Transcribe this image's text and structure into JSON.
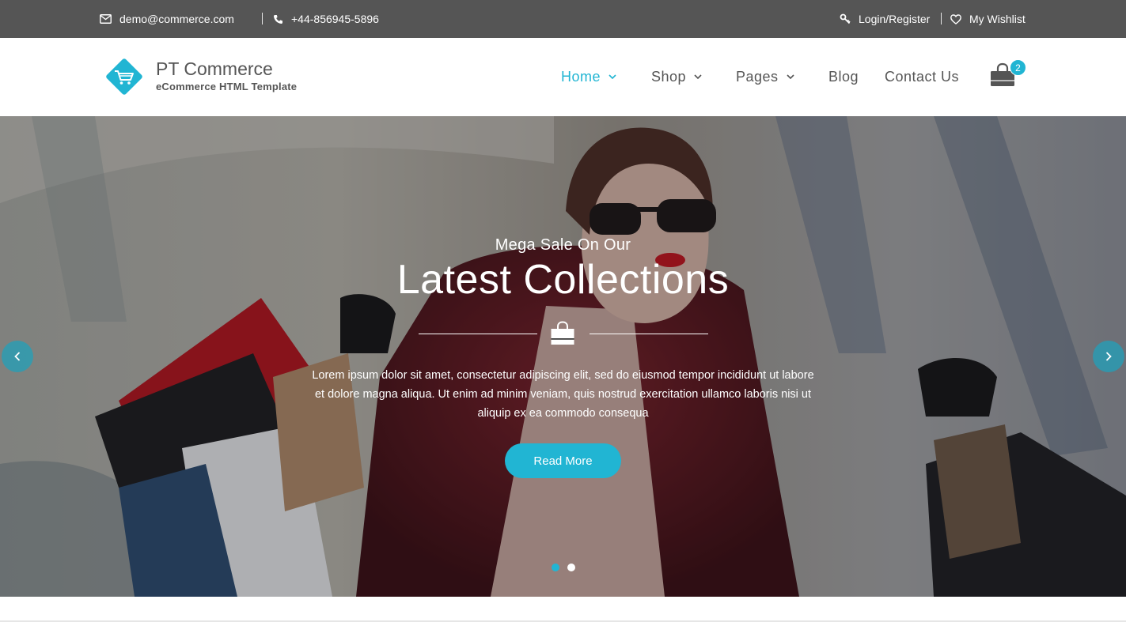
{
  "topbar": {
    "email": "demo@commerce.com",
    "phone": "+44-856945-5896",
    "login": "Login/Register",
    "wishlist": "My Wishlist"
  },
  "brand": {
    "title": "PT Commerce",
    "subtitle": "eCommerce HTML Template",
    "accent": "#21b5d3"
  },
  "nav": {
    "home": "Home",
    "shop": "Shop",
    "pages": "Pages",
    "blog": "Blog",
    "contact": "Contact Us",
    "active": "Home"
  },
  "cart": {
    "count": "2",
    "icon": "shopping-bag-icon"
  },
  "hero": {
    "subtitle": "Mega Sale On Our",
    "title": "Latest Collections",
    "text_line1": "Lorem ipsum dolor sit amet, consectetur adipiscing elit, sed do eiusmod tempor incididunt ut labore",
    "text_line2": "et dolore magna aliqua. Ut enim ad minim veniam, quis nostrud exercitation ullamco laboris nisi ut",
    "text_line3": "aliquip ex ea commodo consequa",
    "button": "Read More",
    "slides": 2,
    "active_slide": 1
  },
  "colors": {
    "topbar_bg": "#555555",
    "text_dark": "#555555",
    "accent": "#21b5d3"
  }
}
